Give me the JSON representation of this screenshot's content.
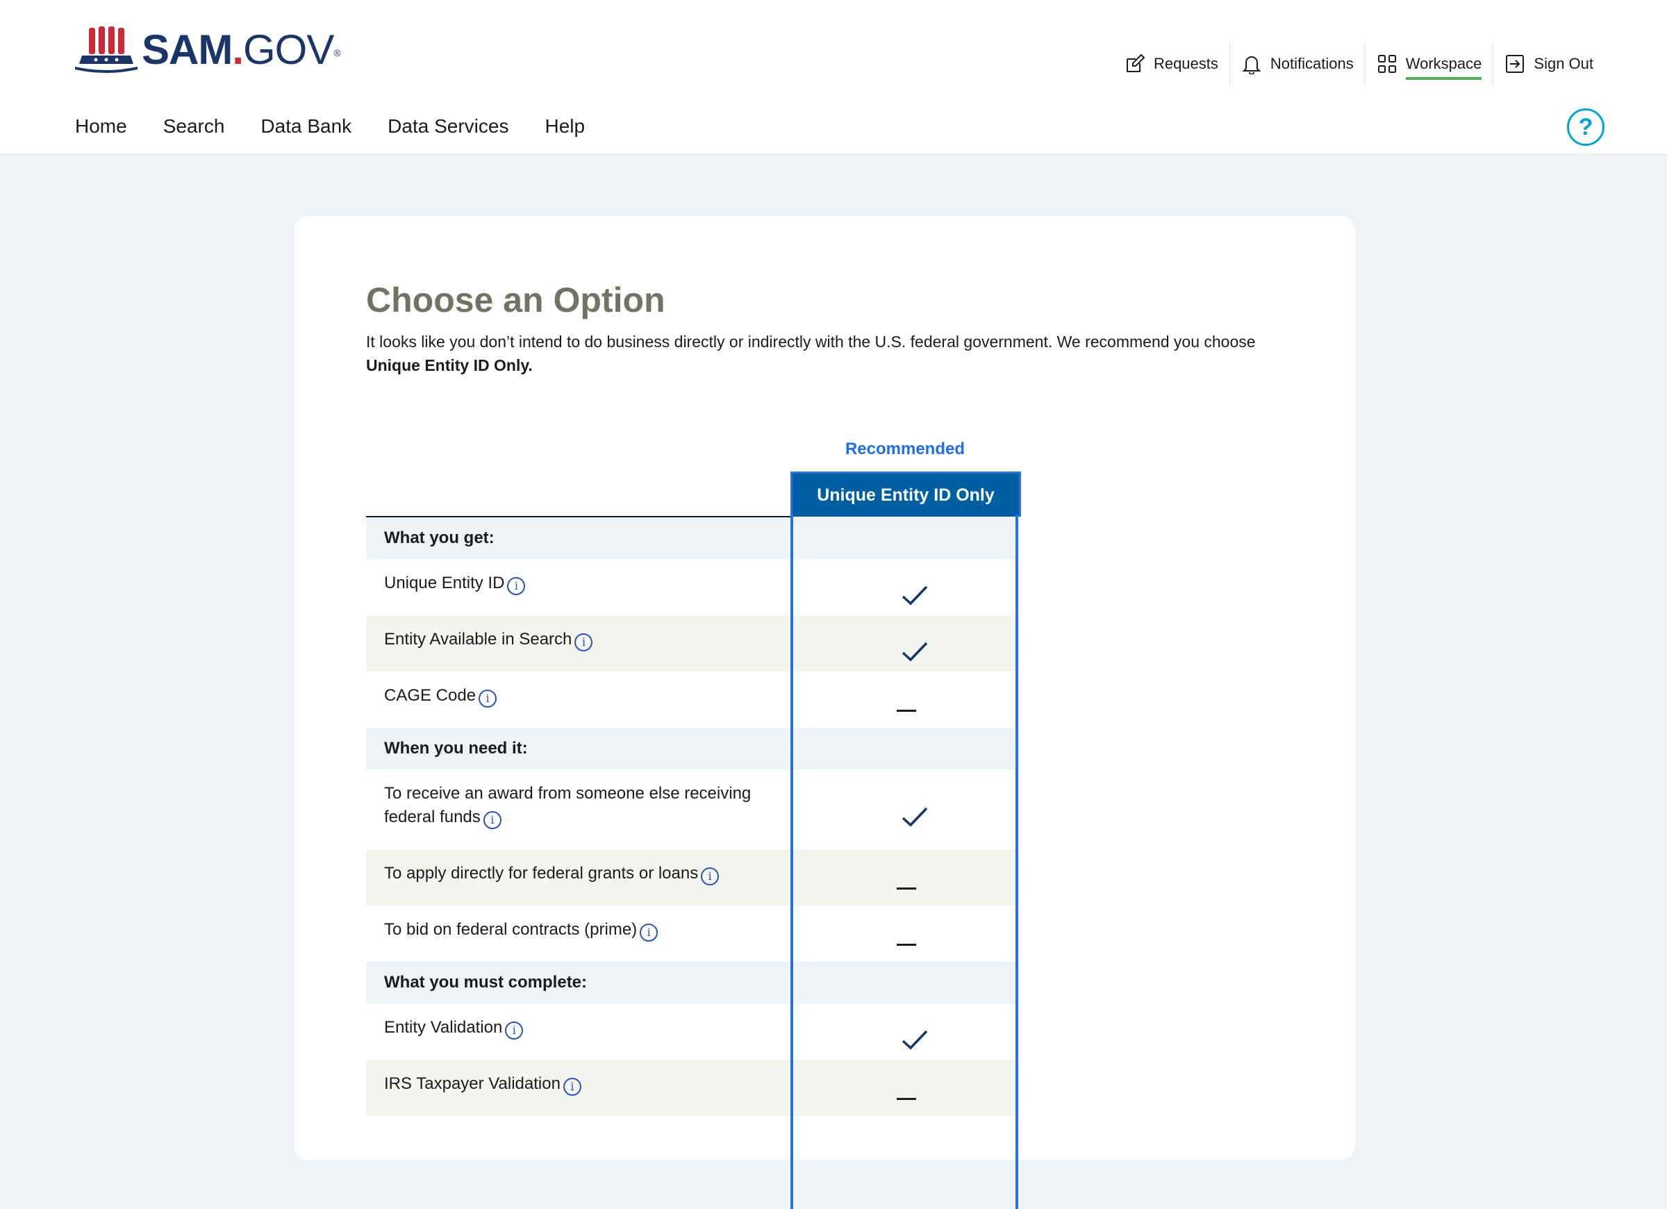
{
  "header": {
    "logo": {
      "sam": "SAM",
      "dot": ".",
      "gov": "GOV",
      "reg": "®"
    },
    "utility": [
      {
        "label": "Requests",
        "icon": "edit-icon"
      },
      {
        "label": "Notifications",
        "icon": "bell-icon"
      },
      {
        "label": "Workspace",
        "icon": "grid-icon",
        "active": true
      },
      {
        "label": "Sign Out",
        "icon": "sign-out-icon"
      }
    ],
    "nav": [
      "Home",
      "Search",
      "Data Bank",
      "Data Services",
      "Help"
    ],
    "help_icon": "?"
  },
  "main": {
    "title": "Choose an Option",
    "description_part1": "It looks like you don’t intend to do business directly or indirectly with the U.S. federal government. We recommend you choose ",
    "description_bold": "Unique Entity ID Only.",
    "recommended_label": "Recommended",
    "column_header": "Unique Entity ID Only",
    "info_glyph": "i",
    "rows": [
      {
        "label": "What you get:",
        "type": "section"
      },
      {
        "label": "Unique Entity ID",
        "value": "check"
      },
      {
        "label": "Entity Available in Search",
        "value": "check"
      },
      {
        "label": "CAGE Code",
        "value": "dash"
      },
      {
        "label": "When you need it:",
        "type": "section"
      },
      {
        "label": "To receive an award from someone else receiving federal funds",
        "value": "check"
      },
      {
        "label": "To apply directly for federal grants or loans",
        "value": "dash"
      },
      {
        "label": "To bid on federal contracts (prime)",
        "value": "dash"
      },
      {
        "label": "What you must complete:",
        "type": "section"
      },
      {
        "label": "Entity Validation",
        "value": "check"
      },
      {
        "label": "IRS Taxpayer Validation",
        "value": "dash"
      }
    ]
  },
  "colors": {
    "brand_navy": "#1a3669",
    "brand_red": "#cc2936",
    "accent_blue": "#2672de",
    "header_blue": "#005ea2",
    "title_gray": "#737364",
    "page_bg": "#edf3f6",
    "active_underline": "#4caf50"
  }
}
